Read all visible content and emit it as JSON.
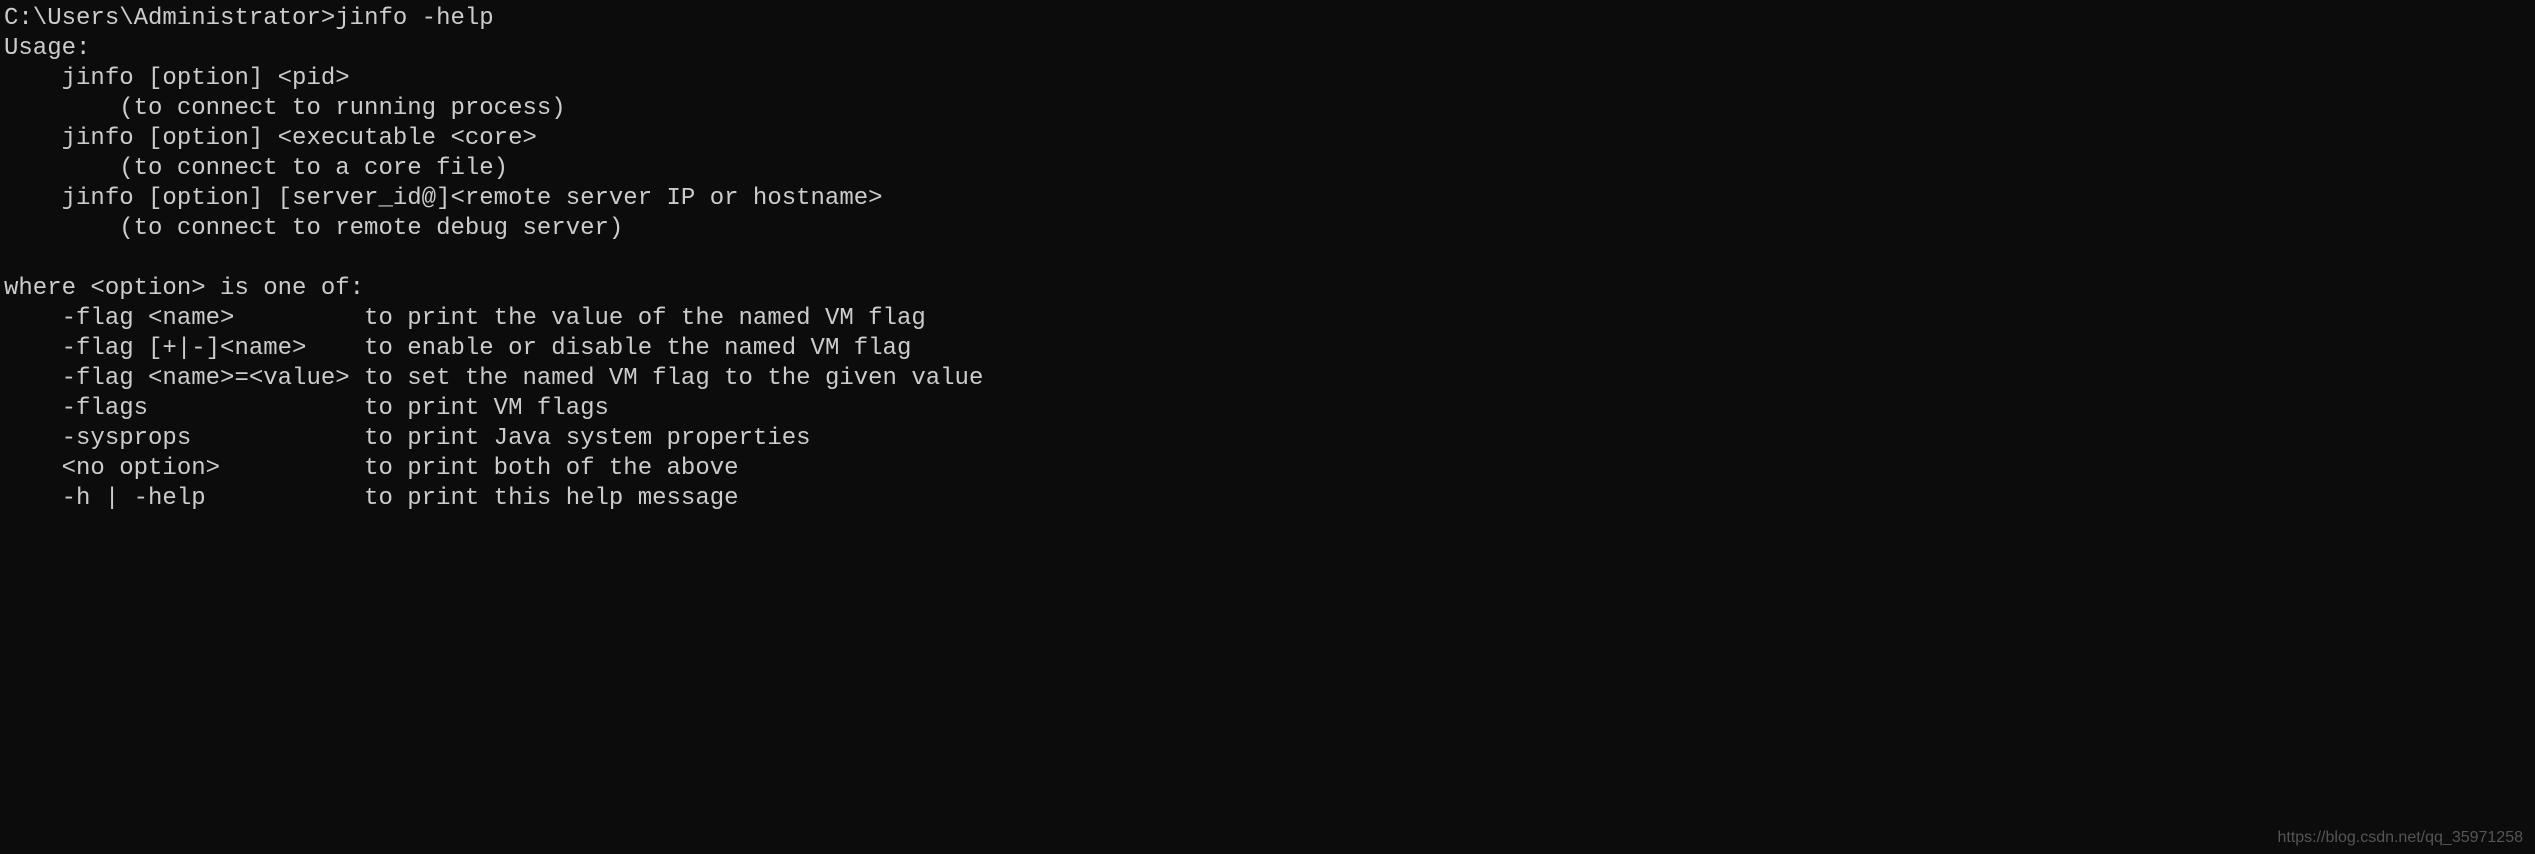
{
  "prompt": {
    "path": "C:\\Users\\Administrator>",
    "command": "jinfo -help"
  },
  "usage_header": "Usage:",
  "usage_lines": [
    "    jinfo [option] <pid>",
    "        (to connect to running process)",
    "    jinfo [option] <executable <core>",
    "        (to connect to a core file)",
    "    jinfo [option] [server_id@]<remote server IP or hostname>",
    "        (to connect to remote debug server)"
  ],
  "blank_line": "",
  "options_header": "where <option> is one of:",
  "options": [
    {
      "flag": "    -flag <name>         ",
      "desc": "to print the value of the named VM flag"
    },
    {
      "flag": "    -flag [+|-]<name>    ",
      "desc": "to enable or disable the named VM flag"
    },
    {
      "flag": "    -flag <name>=<value> ",
      "desc": "to set the named VM flag to the given value"
    },
    {
      "flag": "    -flags               ",
      "desc": "to print VM flags"
    },
    {
      "flag": "    -sysprops            ",
      "desc": "to print Java system properties"
    },
    {
      "flag": "    <no option>          ",
      "desc": "to print both of the above"
    },
    {
      "flag": "    -h | -help           ",
      "desc": "to print this help message"
    }
  ],
  "watermark": "https://blog.csdn.net/qq_35971258"
}
